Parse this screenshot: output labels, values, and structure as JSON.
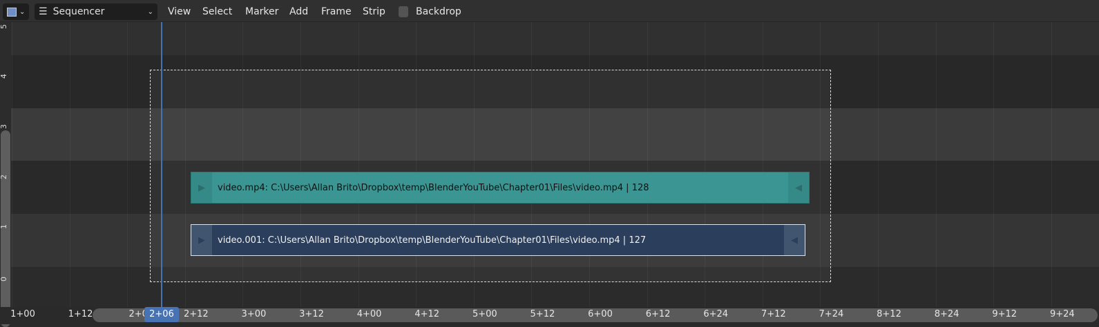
{
  "header": {
    "editor_type_icon": "sequencer-editor-icon",
    "mode": "Sequencer",
    "menus": [
      "View",
      "Select",
      "Marker",
      "Add",
      "Frame",
      "Strip"
    ],
    "backdrop_label": "Backdrop",
    "backdrop_checked": false
  },
  "channels": [
    "0",
    "1",
    "2",
    "3",
    "4",
    "5"
  ],
  "strips": [
    {
      "channel": 2,
      "label": "video.mp4: C:\\Users\\Allan Brito\\Dropbox\\temp\\BlenderYouTube\\Chapter01\\Files\\video.mp4 | 128",
      "color": "#3a9593",
      "selected": false
    },
    {
      "channel": 1,
      "label": "video.001: C:\\Users\\Allan Brito\\Dropbox\\temp\\BlenderYouTube\\Chapter01\\Files\\video.mp4 | 127",
      "color": "#2b3f5c",
      "selected": true
    }
  ],
  "timeline": {
    "labels": [
      "1+00",
      "1+12",
      "2+0",
      "2+12",
      "3+00",
      "3+12",
      "4+00",
      "4+12",
      "5+00",
      "5+12",
      "6+00",
      "6+12",
      "6+24",
      "7+12",
      "7+24",
      "8+12",
      "8+24",
      "9+12",
      "9+24"
    ],
    "current_frame": "2+06",
    "accent": "#4772b3"
  }
}
